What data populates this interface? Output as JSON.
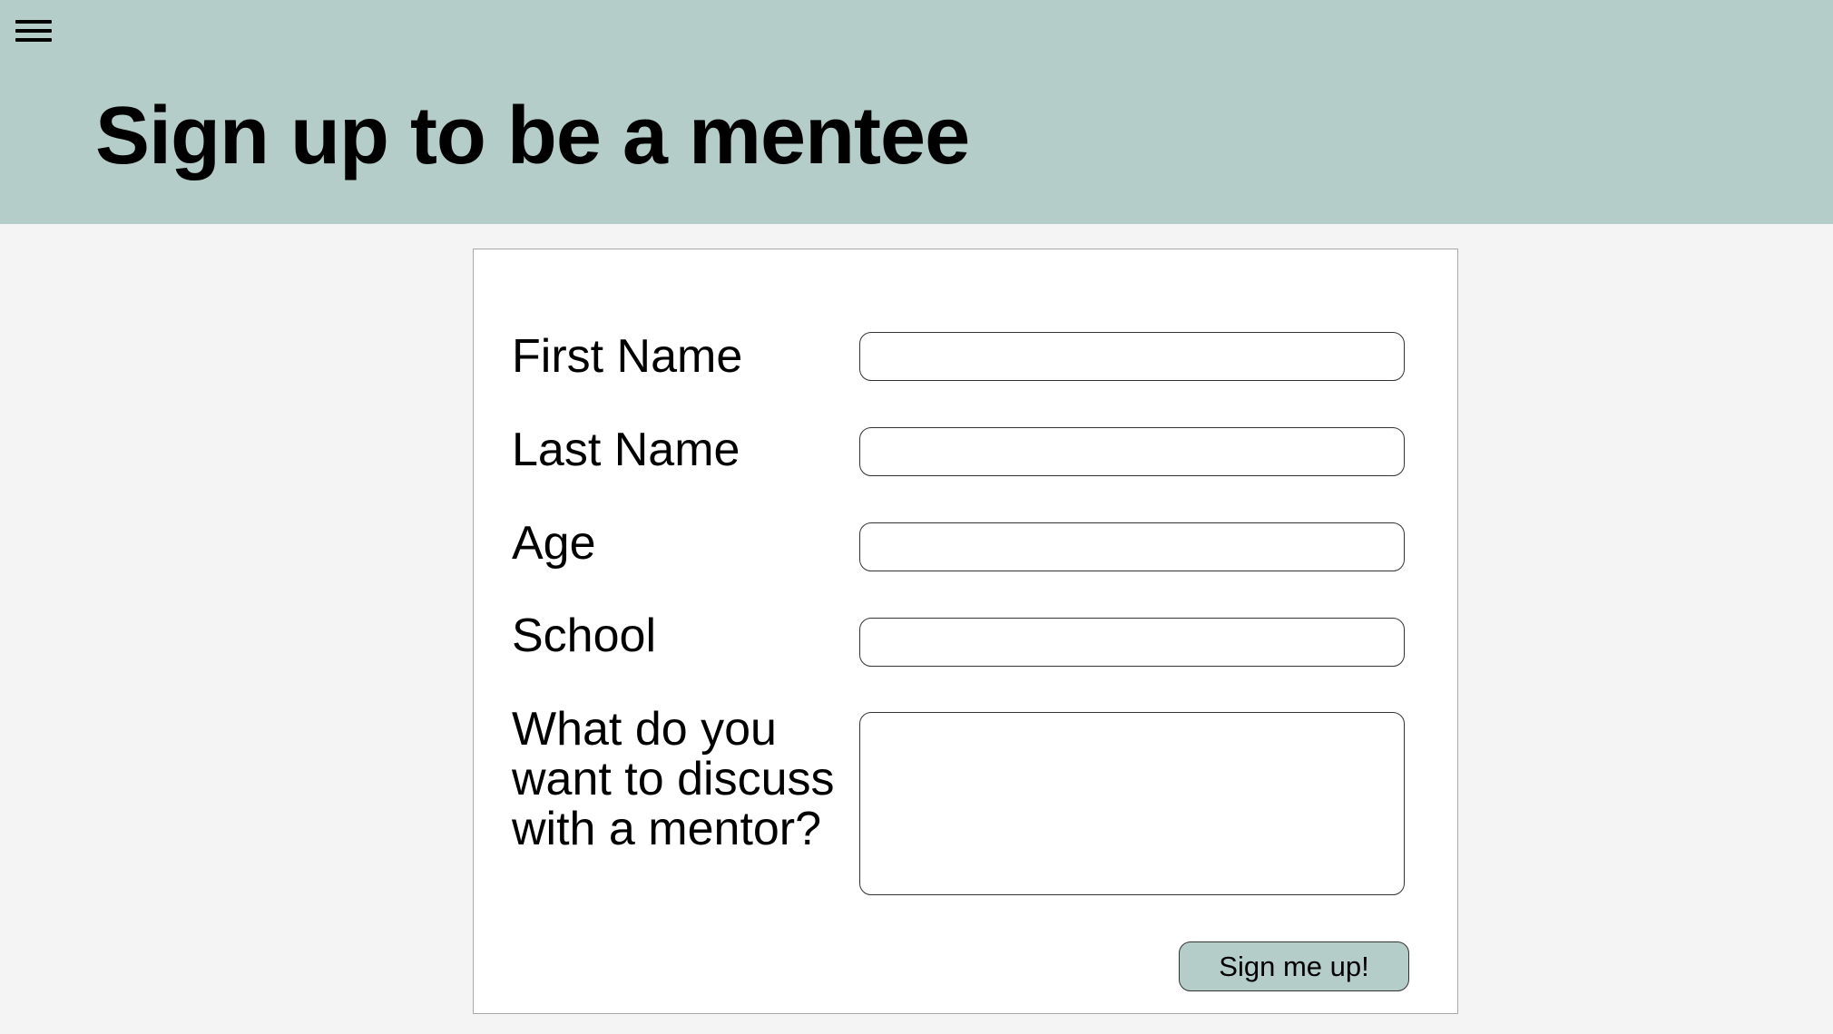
{
  "header": {
    "title": "Sign up to be a mentee",
    "menu_icon": "hamburger-menu-icon",
    "background_color": "#b5cdc8"
  },
  "form": {
    "fields": [
      {
        "label": "First Name",
        "value": "",
        "placeholder": ""
      },
      {
        "label": "Last Name",
        "value": "",
        "placeholder": ""
      },
      {
        "label": "Age",
        "value": "",
        "placeholder": ""
      },
      {
        "label": "School",
        "value": "",
        "placeholder": ""
      }
    ],
    "discussion": {
      "label_lines": [
        "What do you",
        "want to discuss",
        "with a mentor?"
      ],
      "value": "",
      "placeholder": ""
    },
    "submit_label": "Sign me up!",
    "submit_color": "#b5cdc8"
  }
}
